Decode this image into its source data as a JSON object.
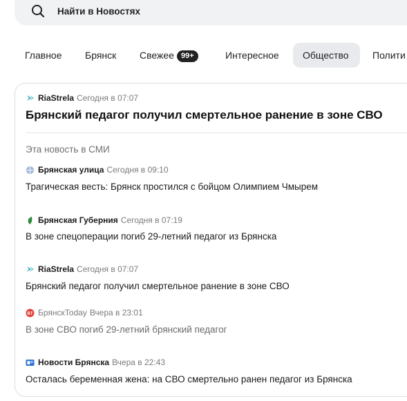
{
  "search": {
    "placeholder": "Найти в Новостях"
  },
  "tabs": [
    {
      "label": "Главное"
    },
    {
      "label": "Брянск"
    },
    {
      "label": "Свежее",
      "badge": "99+"
    },
    {
      "label": "Интересное"
    },
    {
      "label": "Общество",
      "active": true
    },
    {
      "label": "Полити"
    }
  ],
  "story": {
    "source": "RiaStrela",
    "time": "Сегодня в 07:07",
    "headline": "Брянский педагог получил смертельное ранение в зоне СВО"
  },
  "coverage": {
    "label": "Эта новость в СМИ",
    "items": [
      {
        "source": "Брянская улица",
        "time": "Сегодня в 09:10",
        "title": "Трагическая весть: Брянск простился с бойцом Олимпием Чмырем",
        "icon": "globe-icon"
      },
      {
        "source": "Брянская Губерния",
        "time": "Сегодня в 07:19",
        "title": "В зоне спецоперации погиб 29-летний педагог из Брянска",
        "icon": "leaf-icon"
      },
      {
        "source": "RiaStrela",
        "time": "Сегодня в 07:07",
        "title": "Брянский педагог получил смертельное ранение в зоне СВО",
        "icon": "arrow-icon"
      },
      {
        "source": "БрянскToday",
        "time": "Вчера в 23:01",
        "title": "В зоне СВО погиб 29-летний брянский педагог",
        "icon": "bt-icon",
        "dim": true
      },
      {
        "source": "Новости Брянска",
        "time": "Вчера в 22:43",
        "title": "Осталась беременная жена: на СВО смертельно ранен педагог из Брянска",
        "icon": "news-icon"
      }
    ]
  },
  "colors": {
    "active_tab_bg": "#e9eaed",
    "riastrela_teal": "#1aa3b5",
    "bt_red": "#e0433a",
    "news_blue": "#2a6fd6",
    "leaf_green": "#2e8b3a"
  }
}
